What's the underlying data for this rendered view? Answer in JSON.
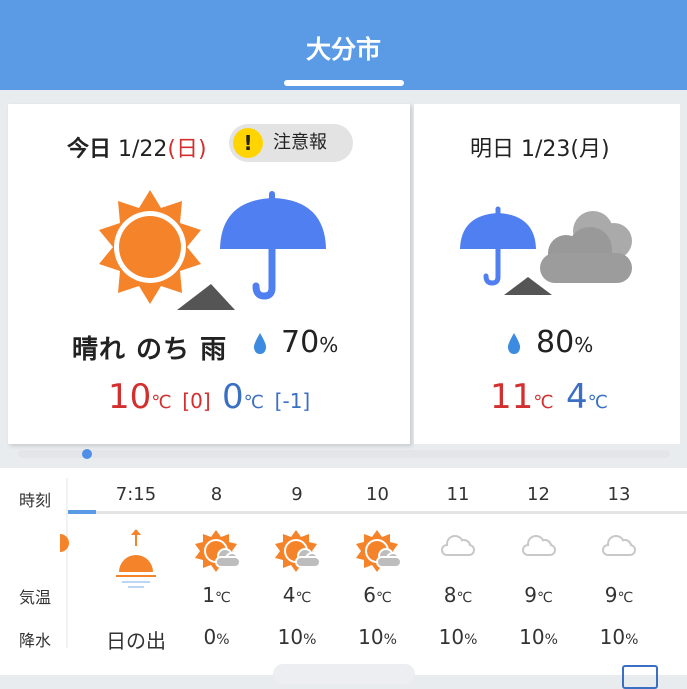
{
  "header": {
    "title": "大分市"
  },
  "today": {
    "label": "今日",
    "date": "1/22",
    "weekday": "(日)",
    "alert": "注意報",
    "alert_mark": "!",
    "weather": "晴れ のち 雨",
    "precip": "70",
    "precip_unit": "%",
    "high": "10",
    "high_unit": "℃",
    "high_diff": "[0]",
    "low": "0",
    "low_unit": "℃",
    "low_diff": "[-1]"
  },
  "tomorrow": {
    "label": "明日",
    "date": "1/23",
    "weekday": "(月)",
    "precip": "80",
    "precip_unit": "%",
    "high": "11",
    "high_unit": "℃",
    "low": "4",
    "low_unit": "℃"
  },
  "hourly": {
    "row_labels": {
      "time": "時刻",
      "temp": "気温",
      "precip": "降水"
    },
    "cols": [
      {
        "time": "7:15",
        "icon": "sunrise-icon",
        "temp": "",
        "temp_unit": "",
        "precip": "日の出",
        "precip_unit": ""
      },
      {
        "time": "8",
        "icon": "sunny-cloud-icon",
        "temp": "1",
        "temp_unit": "℃",
        "precip": "0",
        "precip_unit": "%"
      },
      {
        "time": "9",
        "icon": "sunny-cloud-icon",
        "temp": "4",
        "temp_unit": "℃",
        "precip": "10",
        "precip_unit": "%"
      },
      {
        "time": "10",
        "icon": "sunny-cloud-icon",
        "temp": "6",
        "temp_unit": "℃",
        "precip": "10",
        "precip_unit": "%"
      },
      {
        "time": "11",
        "icon": "cloud-icon",
        "temp": "8",
        "temp_unit": "℃",
        "precip": "10",
        "precip_unit": "%"
      },
      {
        "time": "12",
        "icon": "cloud-icon",
        "temp": "9",
        "temp_unit": "℃",
        "precip": "10",
        "precip_unit": "%"
      },
      {
        "time": "13",
        "icon": "cloud-icon",
        "temp": "9",
        "temp_unit": "℃",
        "precip": "10",
        "precip_unit": "%"
      }
    ]
  },
  "colors": {
    "header": "#5b9be6",
    "sun": "#f5832a",
    "umbrella": "#4f7ff0",
    "cloud": "#aaaaaa",
    "high": "#d32f2f",
    "low": "#3b6fc4"
  }
}
